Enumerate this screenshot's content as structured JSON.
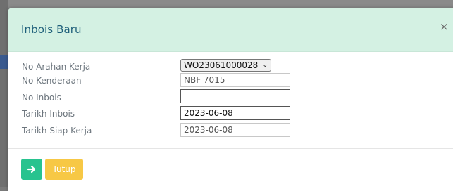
{
  "modal": {
    "title": "Inbois Baru",
    "close_glyph": "×"
  },
  "form": {
    "work_order": {
      "label": "No Arahan Kerja",
      "selected": "WO23061000028",
      "chevron": "⌄"
    },
    "vehicle": {
      "label": "No Kenderaan",
      "value": "NBF 7015"
    },
    "invoice_no": {
      "label": "No Inbois",
      "value": ""
    },
    "invoice_date": {
      "label": "Tarikh Inbois",
      "value": "2023-06-08"
    },
    "ready_date": {
      "label": "Tarikh Siap Kerja",
      "value": "2023-06-08"
    }
  },
  "footer": {
    "next_icon": "arrow-right-icon",
    "close_label": "Tutup"
  },
  "colors": {
    "header_bg": "#d4f1e3",
    "title": "#1e5f7a",
    "success": "#28c38f",
    "warning": "#f7c845"
  }
}
